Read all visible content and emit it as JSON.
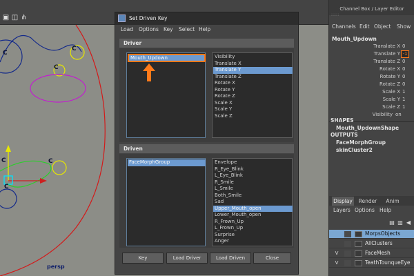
{
  "viewport": {
    "camera_label": "persp",
    "toolbar_icons": [
      "cube-icon",
      "cube-wire-icon",
      "share-icon"
    ],
    "colors": {
      "background": "#8c8d87",
      "selected_control": "#00e5ff",
      "grid_axis": "#2ad02a",
      "axis_x": "#cc2020",
      "axis_y": "#e8e800"
    },
    "controls": [
      "C",
      "C",
      "C",
      "C",
      "C",
      "C"
    ]
  },
  "channel_box": {
    "title": "Channel Box / Layer Editor",
    "menu": [
      "Channels",
      "Edit",
      "Object",
      "Show"
    ],
    "object_name": "Mouth_Updown",
    "attributes": [
      {
        "label": "Translate X",
        "value": "0"
      },
      {
        "label": "Translate Y",
        "value": "-1"
      },
      {
        "label": "Translate Z",
        "value": "0"
      },
      {
        "label": "Rotate X",
        "value": "0"
      },
      {
        "label": "Rotate Y",
        "value": "0"
      },
      {
        "label": "Rotate Z",
        "value": "0"
      },
      {
        "label": "Scale X",
        "value": "1"
      },
      {
        "label": "Scale Y",
        "value": "1"
      },
      {
        "label": "Scale Z",
        "value": "1"
      },
      {
        "label": "Visibility",
        "value": "on"
      }
    ],
    "shapes_header": "SHAPES",
    "shapes": [
      "Mouth_UpdownShape"
    ],
    "outputs_header": "OUTPUTS",
    "outputs": [
      "FaceMorphGroup",
      "skinCluster2"
    ]
  },
  "layer_editor": {
    "tabs": [
      "Display",
      "Render",
      "Anim"
    ],
    "active_tab": "Display",
    "menu": [
      "Layers",
      "Options",
      "Help"
    ],
    "layers": [
      {
        "visible": "",
        "name": "MorpsObjects",
        "selected": true
      },
      {
        "visible": "",
        "name": "AllClusters",
        "selected": false
      },
      {
        "visible": "V",
        "name": "FaceMesh",
        "selected": false
      },
      {
        "visible": "V",
        "name": "TeathTounqueEye",
        "selected": false
      }
    ]
  },
  "sdk": {
    "title": "Set Driven Key",
    "menu": [
      "Load",
      "Options",
      "Key",
      "Select",
      "Help"
    ],
    "driver_header": "Driver",
    "driver_objects": [
      "Mouth_Updown"
    ],
    "driver_attributes": [
      "Visibility",
      "Translate X",
      "Translate Y",
      "Translate Z",
      "Rotate X",
      "Rotate Y",
      "Rotate Z",
      "Scale X",
      "Scale Y",
      "Scale Z"
    ],
    "driver_attr_selected": 2,
    "driven_header": "Driven",
    "driven_objects": [
      "FaceMorphGroup"
    ],
    "driven_attributes": [
      "Envelope",
      "R_Eye_Blink",
      "L_Eye_Blink",
      "R_Smile",
      "L_Smile",
      "Both_Smile",
      "Sad",
      "Upper_Mouth_open",
      "Lower_Mouth_open",
      "R_Frown_Up",
      "L_Frown_Up",
      "Surprise",
      "Anger"
    ],
    "driven_attr_selected": 7,
    "buttons": [
      "Key",
      "Load Driver",
      "Load Driven",
      "Close"
    ],
    "annotation_color": "#ff7a1a"
  }
}
